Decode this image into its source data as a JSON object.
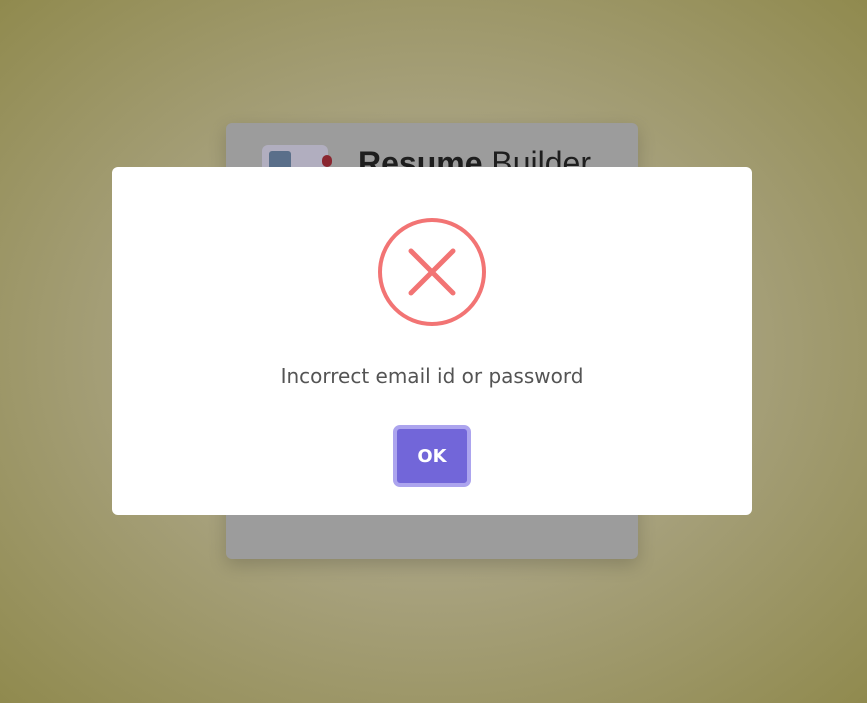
{
  "background_page": {
    "title_bold": "Resume",
    "title_light": " Builder"
  },
  "dialog": {
    "icon": "error-x-circle-icon",
    "message": "Incorrect email id or password",
    "ok_label": "OK",
    "colors": {
      "icon": "#f27474",
      "button": "#7367f0",
      "button_focus_ring": "#a5a0f2"
    }
  }
}
